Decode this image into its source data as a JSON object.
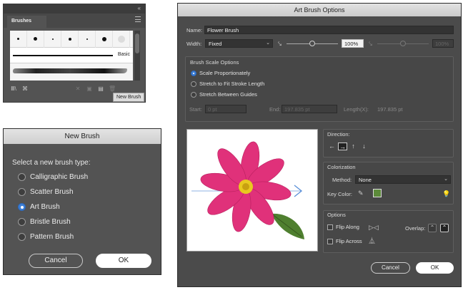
{
  "brushes_panel": {
    "tab_label": "Brushes",
    "collapse_glyph": "«",
    "basic_label": "Basic",
    "tooltip": "New Brush",
    "dot_sizes": [
      0.14,
      0.24,
      0.08,
      0.2,
      0.08,
      0.32,
      0.5
    ],
    "tools": [
      {
        "name": "brush-libraries-icon",
        "glyph": "Ⅲ\\",
        "dim": false
      },
      {
        "name": "library-icon",
        "glyph": "⌘",
        "dim": false
      },
      {
        "name": "remove-stroke-icon",
        "glyph": "✕",
        "dim": true
      },
      {
        "name": "options-icon",
        "glyph": "▣",
        "dim": true
      },
      {
        "name": "new-brush-icon",
        "glyph": "▤",
        "dim": false
      },
      {
        "name": "delete-brush-icon",
        "glyph": "🗑",
        "dim": true
      }
    ]
  },
  "new_brush_dialog": {
    "title": "New Brush",
    "prompt": "Select a new brush type:",
    "options": [
      {
        "label": "Calligraphic Brush",
        "selected": false
      },
      {
        "label": "Scatter Brush",
        "selected": false
      },
      {
        "label": "Art Brush",
        "selected": true
      },
      {
        "label": "Bristle Brush",
        "selected": false
      },
      {
        "label": "Pattern Brush",
        "selected": false
      }
    ],
    "cancel_label": "Cancel",
    "ok_label": "OK"
  },
  "art_brush_options": {
    "title": "Art Brush Options",
    "name_label": "Name:",
    "name_value": "Flower Brush",
    "width_label": "Width:",
    "width_mode": "Fixed",
    "width_percent": "100%",
    "width_percent_dim": "100%",
    "width_level": 0.5,
    "width_level_dim": 0.5,
    "scale_group_title": "Brush Scale Options",
    "scale_options": [
      {
        "label": "Scale Proportionately",
        "selected": true
      },
      {
        "label": "Stretch to Fit Stroke Length",
        "selected": false
      },
      {
        "label": "Stretch Between Guides",
        "selected": false
      }
    ],
    "start_label": "Start:",
    "start_value": "0 pt",
    "end_label": "End:",
    "end_value": "197.835 pt",
    "length_label": "Length(X):",
    "length_value": "197.835 pt",
    "direction_label": "Direction:",
    "direction_arrows": [
      "←",
      "→",
      "↑",
      "↓"
    ],
    "direction_selected": 1,
    "colorization_label": "Colorization",
    "method_label": "Method:",
    "method_value": "None",
    "key_color_label": "Key Color:",
    "key_color_hex": "#5c8a3a",
    "options_label": "Options",
    "flip_along_label": "Flip Along",
    "flip_across_label": "Flip Across",
    "overlap_label": "Overlap:",
    "cancel_label": "Cancel",
    "ok_label": "OK"
  },
  "colors": {
    "panel_bg": "#535353",
    "dialog_bg": "#4b4b4b",
    "accent_blue": "#3d7fd6",
    "flower_pink": "#e0317a",
    "flower_center": "#e8c820",
    "leaf_green": "#4f7f2f",
    "direction_arrow": "#5a8fd8"
  }
}
